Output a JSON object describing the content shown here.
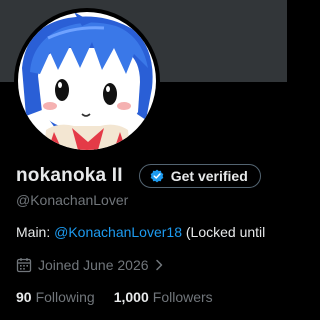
{
  "profile": {
    "display_name": "nokanoka II",
    "handle": "@KonachanLover",
    "avatar_icon": "anime-girl-avatar"
  },
  "verify_button": {
    "label": "Get verified",
    "icon": "verified-badge-icon"
  },
  "bio": {
    "prefix": "Main: ",
    "link_text": "@KonachanLover18",
    "suffix": " (Locked until"
  },
  "joined": {
    "text": "Joined June 2026",
    "icon": "calendar-icon"
  },
  "stats": {
    "following_count": "90",
    "following_label": "Following",
    "followers_count": "1,000",
    "followers_label": "Followers"
  },
  "colors": {
    "background": "#000000",
    "banner": "#323639",
    "text_primary": "#e7e9ea",
    "text_secondary": "#71767b",
    "link": "#1d9bf0",
    "button_border": "#536471"
  }
}
